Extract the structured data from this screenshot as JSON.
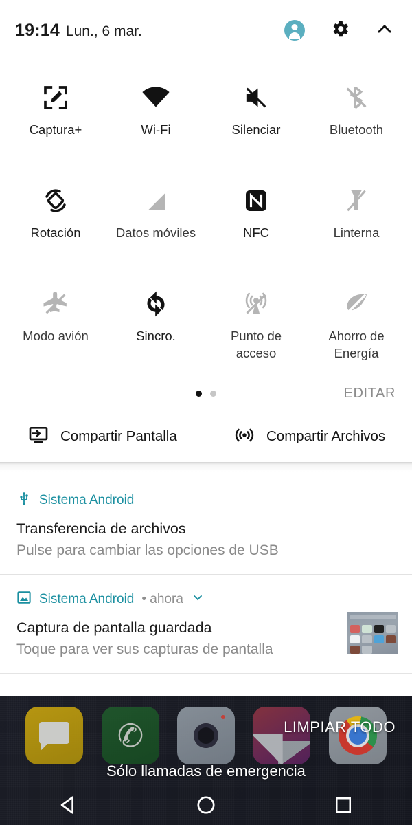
{
  "header": {
    "clock": "19:14",
    "date": "Lun., 6 mar.",
    "avatar_name": "user-avatar",
    "avatar_color": "#5bafc0",
    "settings_label": "gear-icon",
    "collapse_label": "chevron-up-icon"
  },
  "quick_settings": {
    "tiles": [
      {
        "label": "Captura+",
        "icon": "capture-plus-icon",
        "state": "on"
      },
      {
        "label": "Wi-Fi",
        "icon": "wifi-icon",
        "state": "on"
      },
      {
        "label": "Silenciar",
        "icon": "volume-mute-icon",
        "state": "on"
      },
      {
        "label": "Bluetooth",
        "icon": "bluetooth-off-icon",
        "state": "off"
      },
      {
        "label": "Rotación",
        "icon": "auto-rotate-icon",
        "state": "on"
      },
      {
        "label": "Datos móviles",
        "icon": "mobile-data-off-icon",
        "state": "off"
      },
      {
        "label": "NFC",
        "icon": "nfc-icon",
        "state": "on"
      },
      {
        "label": "Linterna",
        "icon": "flashlight-off-icon",
        "state": "off"
      },
      {
        "label": "Modo avión",
        "icon": "airplane-off-icon",
        "state": "off"
      },
      {
        "label": "Sincro.",
        "icon": "sync-icon",
        "state": "on"
      },
      {
        "label": "Punto de acceso",
        "icon": "hotspot-off-icon",
        "state": "off"
      },
      {
        "label": "Ahorro de Energía",
        "icon": "battery-saver-off-icon",
        "state": "off"
      }
    ],
    "pager": {
      "pages": 2,
      "current": 1
    },
    "edit_label": "EDITAR"
  },
  "share_row": [
    {
      "label": "Compartir Pantalla",
      "icon": "screen-share-icon"
    },
    {
      "label": "Compartir Archivos",
      "icon": "file-share-icon"
    }
  ],
  "notifications": [
    {
      "app": "Sistema Android",
      "meta": "",
      "title": "Transferencia de archivos",
      "body": "Pulse para cambiar las opciones de USB",
      "icon": "usb-icon",
      "has_thumbnail": false
    },
    {
      "app": "Sistema Android",
      "meta": "• ahora",
      "title": "Captura de pantalla guardada",
      "body": "Toque para ver sus capturas de pantalla",
      "icon": "image-icon",
      "has_thumbnail": true
    }
  ],
  "bottom": {
    "clear_all": "LIMPIAR TODO",
    "carrier": "Sólo llamadas de emergencia",
    "dock_apps": [
      {
        "name": "messages-app-icon"
      },
      {
        "name": "phone-app-icon"
      },
      {
        "name": "camera-app-icon"
      },
      {
        "name": "gallery-app-icon"
      },
      {
        "name": "chrome-app-icon"
      }
    ]
  },
  "navbar": {
    "back": "back-button",
    "home": "home-button",
    "recents": "recents-button"
  },
  "colors": {
    "accent_teal": "#1a8fa0",
    "tile_on": "#121212",
    "tile_off": "#b5b5b5",
    "panel_bg": "#ffffff"
  }
}
